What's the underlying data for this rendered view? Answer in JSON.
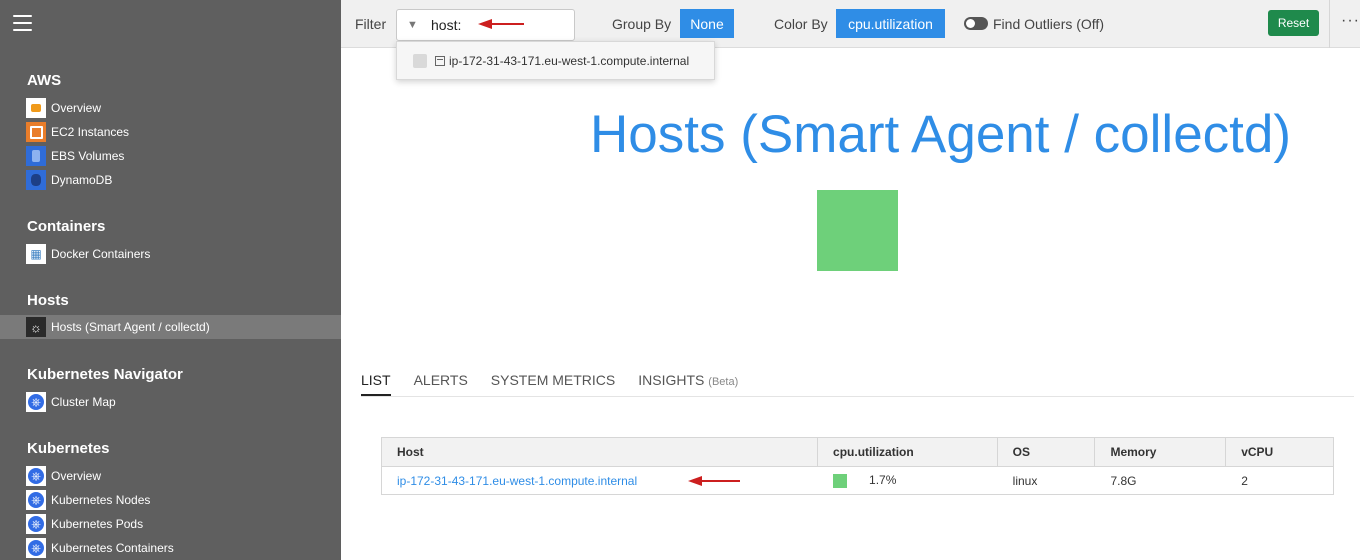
{
  "sidebar": {
    "sections": [
      {
        "title": "AWS",
        "items": [
          {
            "label": "Overview",
            "icon": "aws-icon"
          },
          {
            "label": "EC2 Instances",
            "icon": "ec2-icon"
          },
          {
            "label": "EBS Volumes",
            "icon": "ebs-icon"
          },
          {
            "label": "DynamoDB",
            "icon": "dynamodb-icon"
          }
        ]
      },
      {
        "title": "Containers",
        "items": [
          {
            "label": "Docker Containers",
            "icon": "docker-icon"
          }
        ]
      },
      {
        "title": "Hosts",
        "items": [
          {
            "label": "Hosts (Smart Agent / collectd)",
            "icon": "host-icon",
            "active": true
          }
        ]
      },
      {
        "title": "Kubernetes Navigator",
        "items": [
          {
            "label": "Cluster Map",
            "icon": "kubernetes-icon"
          }
        ]
      },
      {
        "title": "Kubernetes",
        "items": [
          {
            "label": "Overview",
            "icon": "kubernetes-icon"
          },
          {
            "label": "Kubernetes Nodes",
            "icon": "kubernetes-icon"
          },
          {
            "label": "Kubernetes Pods",
            "icon": "kubernetes-icon"
          },
          {
            "label": "Kubernetes Containers",
            "icon": "kubernetes-icon"
          }
        ]
      }
    ]
  },
  "toolbar": {
    "filter_label": "Filter",
    "filter_value": "host:",
    "group_by_label": "Group By",
    "group_by_value": "None",
    "color_by_label": "Color By",
    "color_by_value": "cpu.utilization",
    "outliers_label": "Find Outliers (Off)",
    "reset_label": "Reset",
    "more_label": "···"
  },
  "dropdown": {
    "option": "ip-172-31-43-171.eu-west-1.compute.internal"
  },
  "main": {
    "title": "Hosts (Smart Agent / collectd)",
    "tabs": [
      {
        "label": "LIST",
        "active": true
      },
      {
        "label": "ALERTS"
      },
      {
        "label": "SYSTEM METRICS"
      },
      {
        "label": "INSIGHTS",
        "sub": "(Beta)"
      }
    ],
    "table": {
      "headers": [
        "Host",
        "cpu.utilization",
        "OS",
        "Memory",
        "vCPU"
      ],
      "rows": [
        {
          "host": "ip-172-31-43-171.eu-west-1.compute.internal",
          "cpu": "1.7%",
          "os": "linux",
          "memory": "7.8G",
          "vcpu": "2"
        }
      ]
    }
  },
  "colors": {
    "accent_blue": "#2f8de6",
    "reset_green": "#1f8a4c",
    "heatmap_green": "#6ed07a",
    "annotation_red": "#cc1f1f"
  }
}
